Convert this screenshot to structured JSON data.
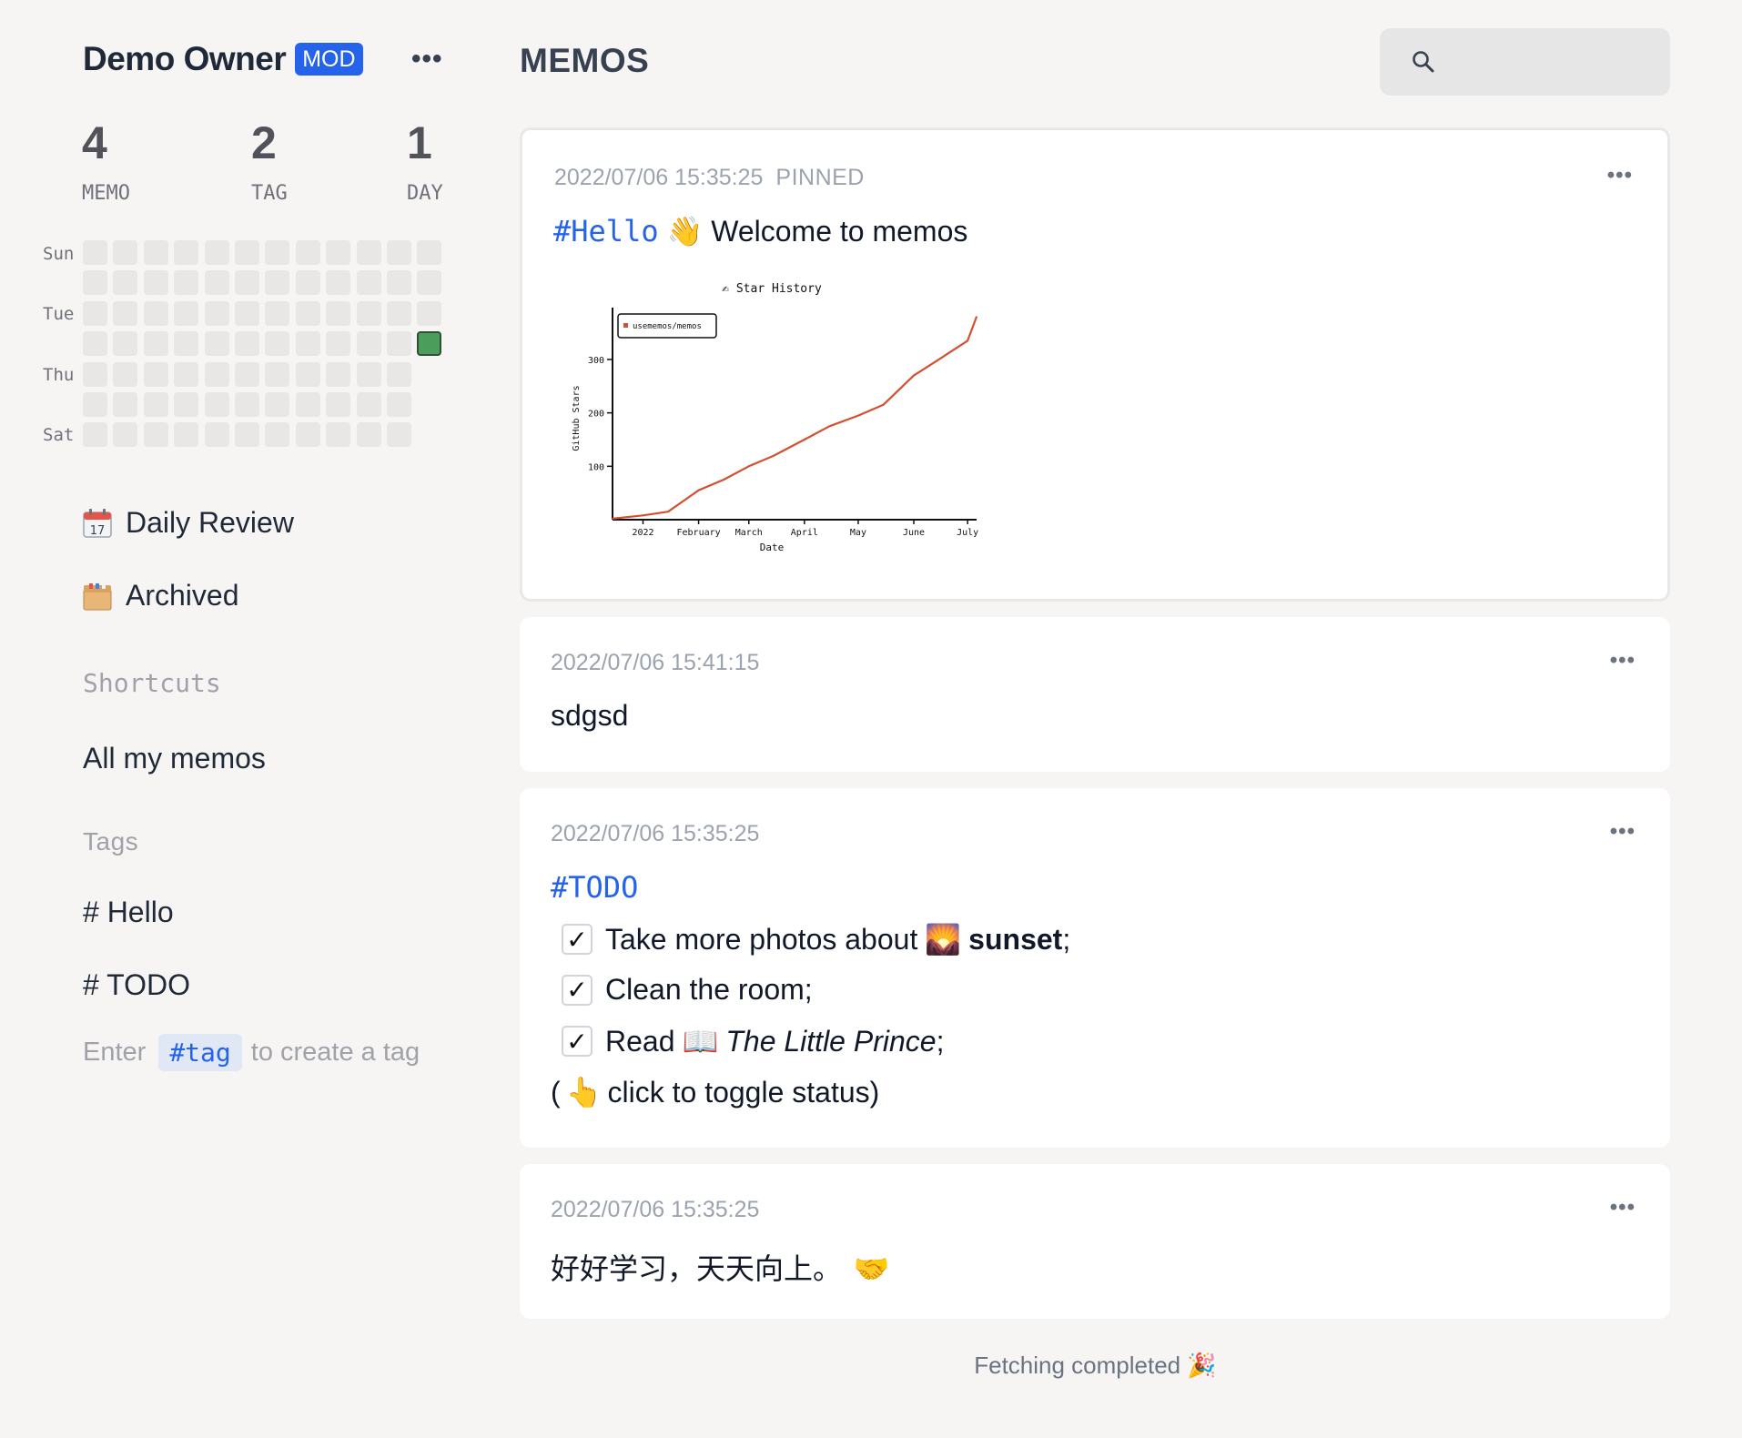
{
  "sidebar": {
    "user_name": "Demo Owner",
    "role_badge": "MOD",
    "menu_icon": "more-horizontal-icon",
    "stats": [
      {
        "value": "4",
        "label": "MEMO"
      },
      {
        "value": "2",
        "label": "TAG"
      },
      {
        "value": "1",
        "label": "DAY"
      }
    ],
    "heatmap": {
      "day_labels": [
        "Sun",
        "Tue",
        "Thu",
        "Sat"
      ],
      "active_color": "#4a9d5b",
      "empty_color": "#e8e7e6"
    },
    "nav": [
      {
        "label": "Daily Review",
        "icon": "calendar-icon"
      },
      {
        "label": "Archived",
        "icon": "archive-box-icon"
      }
    ],
    "shortcuts_title": "Shortcuts",
    "shortcuts": [
      "All my memos"
    ],
    "tags_title": "Tags",
    "tags": [
      "# Hello",
      "# TODO"
    ],
    "tag_hint": {
      "prefix": "Enter",
      "code": "#tag",
      "suffix": "to create a tag"
    }
  },
  "header": {
    "title": "MEMOS",
    "search_icon": "search-icon",
    "search_placeholder": ""
  },
  "memos": [
    {
      "timestamp": "2022/07/06 15:35:25",
      "pinned_label": "PINNED",
      "tag": "#Hello",
      "text": "Welcome to memos"
    },
    {
      "timestamp": "2022/07/06 15:41:15",
      "text": "sdgsd"
    },
    {
      "timestamp": "2022/07/06 15:35:25",
      "tag": "#TODO",
      "todos": [
        {
          "checkmark": "✓",
          "text": "Take more photos about",
          "bold": "sunset",
          "tail": ";"
        },
        {
          "checkmark": "✓",
          "text": "Clean the room;"
        },
        {
          "checkmark": "✓",
          "text": "Read",
          "italic": "The Little Prince",
          "tail": ";"
        }
      ],
      "footer_open": "(",
      "footer_text": "click to toggle status)"
    },
    {
      "timestamp": "2022/07/06 15:35:25",
      "text": "好好学习，天天向上。"
    }
  ],
  "chart_data": {
    "type": "line",
    "title": "Star History",
    "xlabel": "Date",
    "ylabel": "GitHub Stars",
    "x_ticks": [
      "2022",
      "February",
      "March",
      "April",
      "May",
      "June",
      "July"
    ],
    "y_ticks": [
      100,
      200,
      300
    ],
    "series": [
      {
        "name": "usememos/memos",
        "color": "#d4502f",
        "x": [
          "2021-12-15",
          "2022-01-01",
          "2022-01-15",
          "2022-02-01",
          "2022-02-15",
          "2022-03-01",
          "2022-03-15",
          "2022-04-01",
          "2022-04-15",
          "2022-05-01",
          "2022-05-15",
          "2022-06-01",
          "2022-06-15",
          "2022-07-01",
          "2022-07-06"
        ],
        "values": [
          2,
          8,
          15,
          55,
          75,
          100,
          120,
          150,
          175,
          195,
          215,
          270,
          300,
          335,
          380
        ]
      }
    ]
  },
  "footer": {
    "status": "Fetching completed",
    "status_icon": "party-popper-icon"
  }
}
